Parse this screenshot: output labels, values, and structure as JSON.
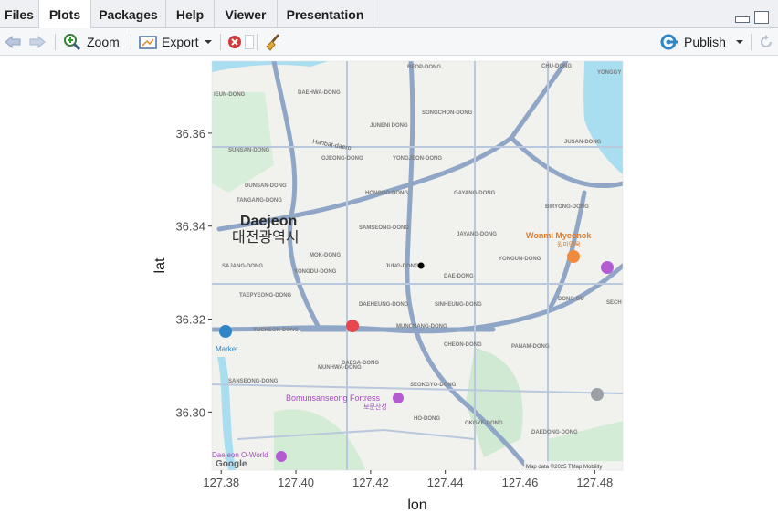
{
  "tabs": [
    {
      "label": "Files"
    },
    {
      "label": "Plots"
    },
    {
      "label": "Packages"
    },
    {
      "label": "Help"
    },
    {
      "label": "Viewer"
    },
    {
      "label": "Presentation"
    }
  ],
  "active_tab": "Plots",
  "toolbar": {
    "zoom_label": "Zoom",
    "export_label": "Export",
    "publish_label": "Publish"
  },
  "icons": [
    "back-arrow-icon",
    "forward-arrow-icon",
    "zoom-icon",
    "export-icon",
    "dropdown-caret-icon",
    "remove-plot-icon",
    "broom-icon",
    "publish-icon",
    "refresh-icon",
    "minimize-icon",
    "maximize-icon"
  ],
  "colors": {
    "accent": "#1f6fb5",
    "marker": "#000000",
    "water": "#a8def0",
    "road": "#8fa6c7",
    "park": "#c8ebd0"
  },
  "chart_data": {
    "type": "scatter",
    "xlabel": "lon",
    "ylabel": "lat",
    "xlim": [
      127.3775,
      127.4875
    ],
    "ylim": [
      36.2875,
      36.3755
    ],
    "x_ticks": [
      "127.38",
      "127.40",
      "127.42",
      "127.44",
      "127.46",
      "127.48"
    ],
    "y_ticks": [
      "36.30",
      "36.32",
      "36.34",
      "36.36"
    ],
    "points": [
      {
        "x": 127.4335,
        "y": 36.3315
      }
    ],
    "background": "basemap",
    "grid": false
  },
  "map_labels": {
    "city_en": "Daejeon",
    "city_ko": "대전광역시",
    "poi_1": "Wonmi Myeonok",
    "poi_1_ko": "원미면옥",
    "poi_2": "Bomunsanseong Fortress",
    "poi_2_ko": "보문산성",
    "poi_3": "Daejeon O-World",
    "market": "Market",
    "road_1": "Hanbat-daero",
    "districts": [
      "DAEHWA-DONG",
      "JUNENI DONG",
      "SONGCHON-DONG",
      "JUSAN-DONG",
      "YONGJEON-DONG",
      "OJEONG-DONG",
      "HONGDO-DONG",
      "GAYANG-DONG",
      "SAMSEONG-DONG",
      "JAYANG-DONG",
      "JUNG-DONG",
      "DAE-DONG",
      "YONGDU-DONG",
      "MOK-DONG",
      "DAEHEUNG-DONG",
      "MUNCHANG-DONG",
      "SINHEUNG-DONG",
      "CHEON-DONG",
      "PANAM-DONG",
      "SEOKGYO-DONG",
      "DAESA-DONG",
      "MUNHWA-DONG",
      "YUCHEON-DONG",
      "TAEPYEONG-DONG",
      "SAJANG-DONG",
      "HO-DONG",
      "OKGYE-DONG",
      "DAEDONG-DONG",
      "BIRYONG-DONG",
      "YONGUN-DONG",
      "SANSEONG-DONG",
      "BEOP-DONG",
      "CHU-DONG",
      "YONGGY",
      "DONG GU",
      "SECH",
      "TANGANG-DONG",
      "SUNSAN-DONG",
      "DUNSAN-DONG",
      "IEUN-DONG"
    ],
    "credit": "Map data ©2025 TMap Mobility",
    "google": "Google"
  }
}
